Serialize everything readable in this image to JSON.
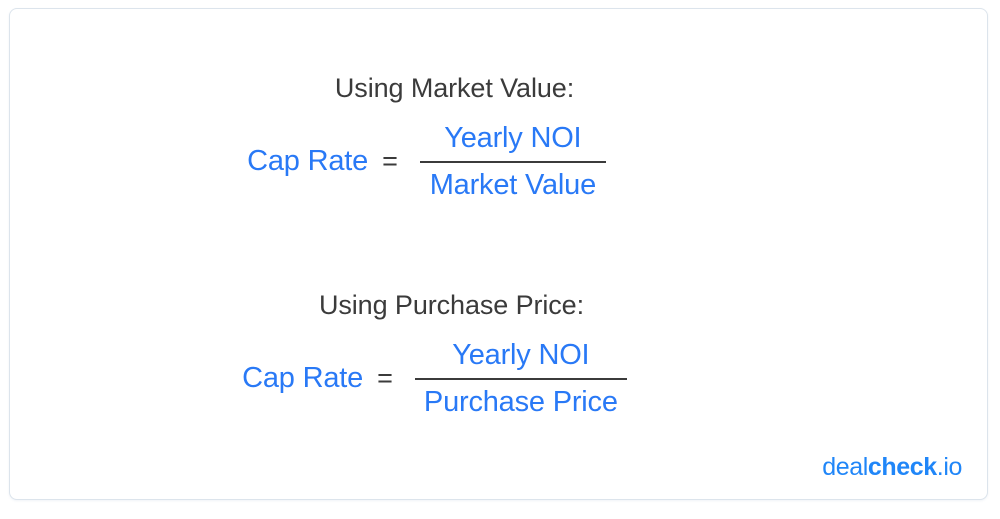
{
  "card": {
    "border_color": "#dce4ec",
    "background": "#ffffff"
  },
  "colors": {
    "accent_blue": "#2979f6",
    "logo_blue": "#2086f8",
    "text_dark": "#3b3b3b"
  },
  "formulas": [
    {
      "id": "market-value",
      "heading": "Using Market Value:",
      "lhs": "Cap Rate",
      "operator": "=",
      "numerator": "Yearly NOI",
      "denominator": "Market Value"
    },
    {
      "id": "purchase-price",
      "heading": "Using Purchase Price:",
      "lhs": "Cap Rate",
      "operator": "=",
      "numerator": "Yearly NOI",
      "denominator": "Purchase Price"
    }
  ],
  "logo": {
    "part1": "deal",
    "part2": "check",
    "part3": ".io",
    "full": "dealcheck.io"
  }
}
